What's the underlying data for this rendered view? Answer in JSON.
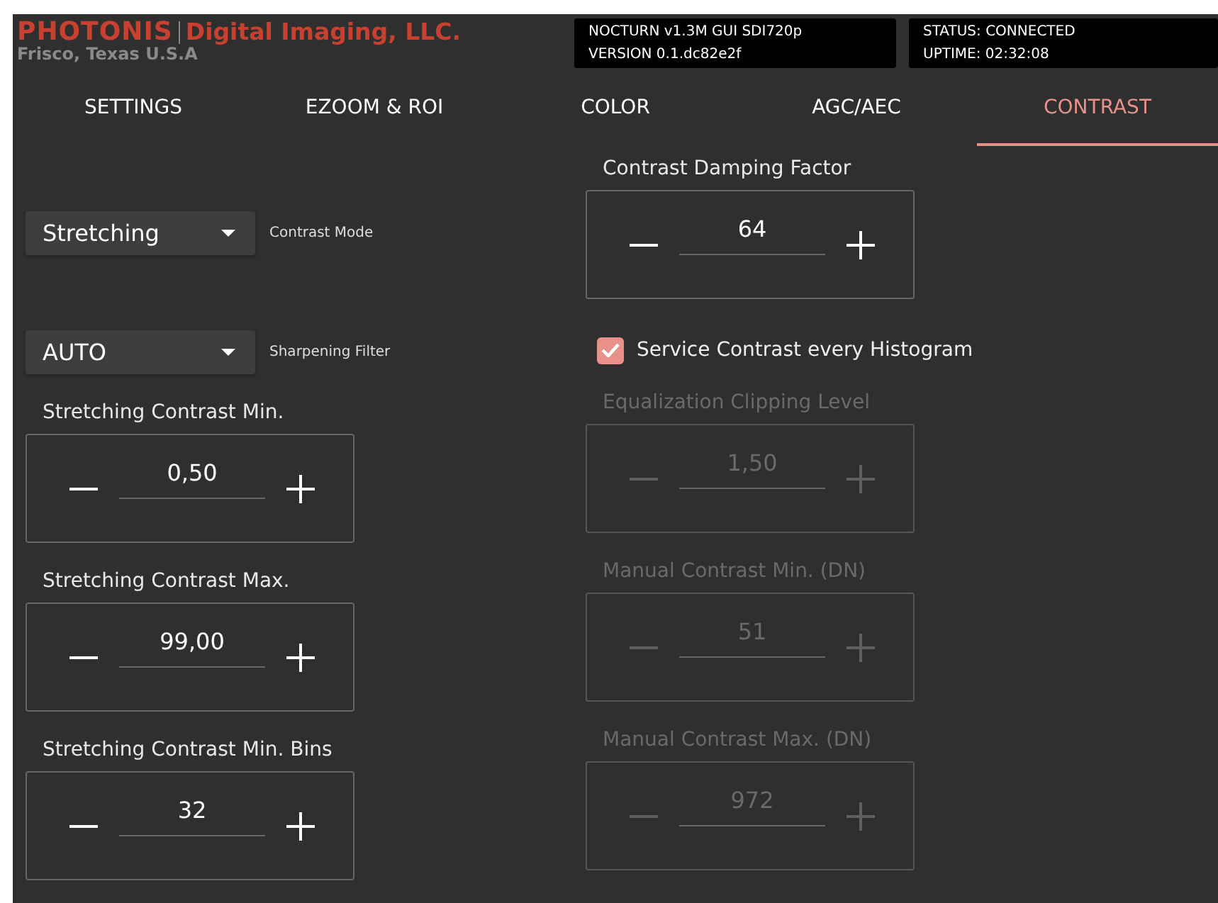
{
  "header": {
    "brand": "PHOTONIS",
    "company": "Digital Imaging, LLC.",
    "location": "Frisco, Texas U.S.A",
    "info_boxes": [
      {
        "lines": [
          "NOCTURN v1.3M GUI SDI720p",
          "VERSION 0.1.dc82e2f"
        ]
      },
      {
        "lines": [
          "STATUS: CONNECTED",
          "UPTIME: 02:32:08"
        ]
      }
    ]
  },
  "tabs": [
    {
      "label": "SETTINGS",
      "selected": false
    },
    {
      "label": "EZOOM & ROI",
      "selected": false
    },
    {
      "label": "COLOR",
      "selected": false
    },
    {
      "label": "AGC/AEC",
      "selected": false
    },
    {
      "label": "CONTRAST",
      "selected": true
    }
  ],
  "dropdowns": [
    {
      "value": "Stretching",
      "label": "Contrast Mode"
    },
    {
      "value": "AUTO",
      "label": "Sharpening Filter"
    }
  ],
  "damping": {
    "label": "Contrast Damping Factor",
    "value": "64",
    "disabled": false
  },
  "checkbox": {
    "label": "Service Contrast every Histogram",
    "checked": true
  },
  "left_spinners": [
    {
      "label": "Stretching Contrast Min.",
      "value": "0,50",
      "disabled": false
    },
    {
      "label": "Stretching Contrast Max.",
      "value": "99,00",
      "disabled": false
    },
    {
      "label": "Stretching Contrast Min. Bins",
      "value": "32",
      "disabled": false
    }
  ],
  "right_spinners": [
    {
      "label": "Equalization Clipping Level",
      "value": "1,50",
      "disabled": true
    },
    {
      "label": "Manual Contrast Min. (DN)",
      "value": "51",
      "disabled": true
    },
    {
      "label": "Manual Contrast Max. (DN)",
      "value": "972",
      "disabled": true
    }
  ]
}
